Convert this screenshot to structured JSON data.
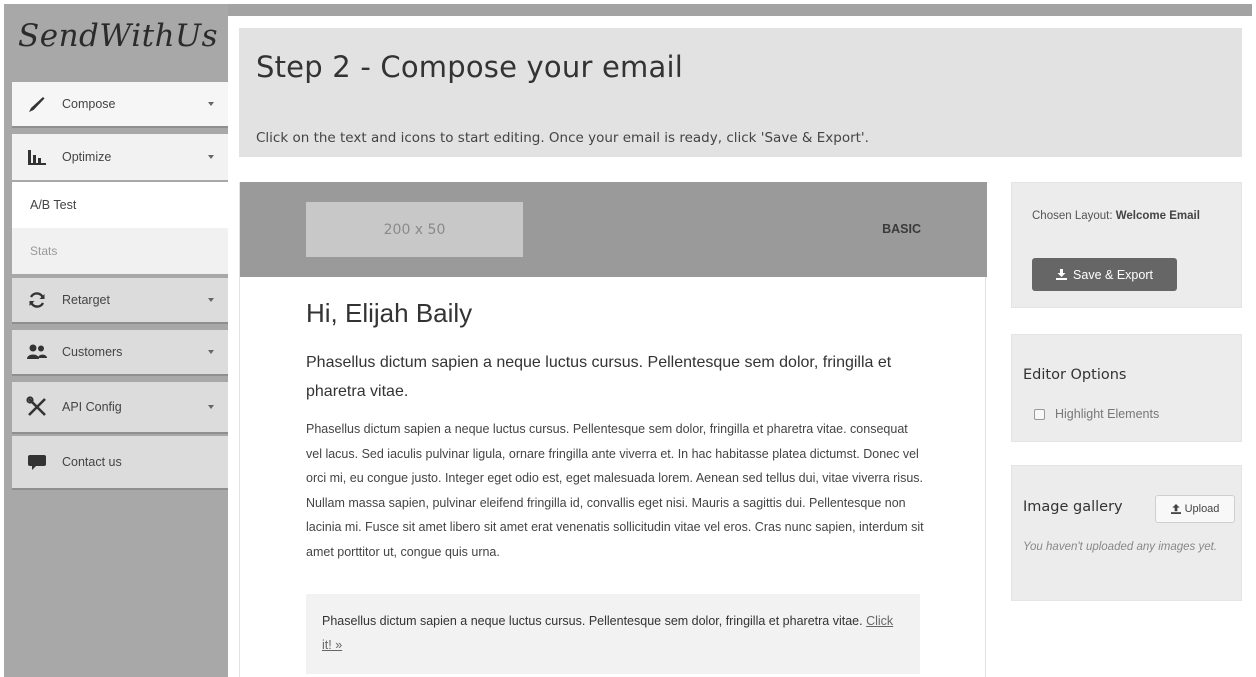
{
  "brand": {
    "logo_text": "SendWithUs"
  },
  "sidebar": {
    "items": [
      {
        "label": "Compose",
        "icon": "brush-icon"
      },
      {
        "label": "Optimize",
        "icon": "bar-chart-icon"
      },
      {
        "label": "Retarget",
        "icon": "refresh-icon"
      },
      {
        "label": "Customers",
        "icon": "users-icon"
      },
      {
        "label": "API Config",
        "icon": "tools-icon"
      },
      {
        "label": "Contact us",
        "icon": "chat-icon"
      }
    ],
    "optimize_sub": [
      {
        "label": "A/B Test"
      },
      {
        "label": "Stats"
      }
    ]
  },
  "header": {
    "title": "Step 2 - Compose your email",
    "subtitle": "Click on the text and icons to start editing. Once your email is ready, click 'Save & Export'."
  },
  "email": {
    "logo_placeholder": "200 x 50",
    "template_label": "BASIC",
    "greeting": "Hi, Elijah Baily",
    "lead": "Phasellus dictum sapien a neque luctus cursus. Pellentesque sem dolor, fringilla et pharetra vitae.",
    "body": "Phasellus dictum sapien a neque luctus cursus. Pellentesque sem dolor, fringilla et pharetra vitae. consequat vel lacus. Sed iaculis pulvinar ligula, ornare fringilla ante viverra et. In hac habitasse platea dictumst. Donec vel orci mi, eu congue justo. Integer eget odio est, eget malesuada lorem. Aenean sed tellus dui, vitae viverra risus. Nullam massa sapien, pulvinar eleifend fringilla id, convallis eget nisi. Mauris a sagittis dui. Pellentesque non lacinia mi. Fusce sit amet libero sit amet erat venenatis sollicitudin vitae vel eros. Cras nunc sapien, interdum sit amet porttitor ut, congue quis urna.",
    "callout_text": "Phasellus dictum sapien a neque luctus cursus. Pellentesque sem dolor, fringilla et pharetra vitae.",
    "callout_link": "Click it! »"
  },
  "layout_panel": {
    "label": "Chosen Layout:",
    "value": "Welcome Email",
    "save_button": "Save & Export"
  },
  "editor_options": {
    "title": "Editor Options",
    "highlight_label": "Highlight Elements",
    "highlight_checked": false
  },
  "gallery": {
    "title": "Image gallery",
    "upload_button": "Upload",
    "empty_text": "You haven't uploaded any images yet."
  }
}
